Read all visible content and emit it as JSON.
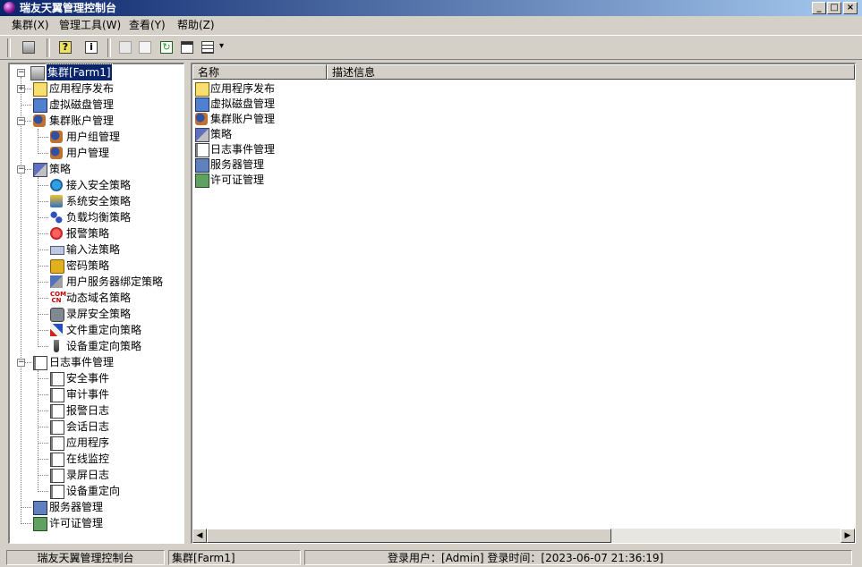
{
  "window": {
    "title": "瑞友天翼管理控制台",
    "min": "_",
    "max": "□",
    "close": "×"
  },
  "menu": [
    "集群(X)",
    "管理工具(W)",
    "查看(Y)",
    "帮助(Z)"
  ],
  "toolbar": {
    "buttons": [
      "cluster-icon",
      "help-icon",
      "info-icon",
      "copy-icon",
      "page-icon",
      "refresh-icon",
      "properties-icon",
      "view-grid-icon"
    ],
    "dropdown": "▾"
  },
  "tree": {
    "root": {
      "label": "集群[Farm1]",
      "expander": "⊟"
    },
    "items": [
      {
        "label": "应用程序发布",
        "icon": "folder-icon",
        "expander": "⊞"
      },
      {
        "label": "虚拟磁盘管理",
        "icon": "disk-icon"
      },
      {
        "label": "集群账户管理",
        "icon": "users-icon",
        "expander": "⊟"
      },
      {
        "label": "用户组管理",
        "icon": "users-icon"
      },
      {
        "label": "用户管理",
        "icon": "users-icon"
      },
      {
        "label": "策略",
        "icon": "policy-icon",
        "expander": "⊟"
      },
      {
        "label": "接入安全策略",
        "icon": "globe-icon"
      },
      {
        "label": "系统安全策略",
        "icon": "shield-icon"
      },
      {
        "label": "负载均衡策略",
        "icon": "network-icon"
      },
      {
        "label": "报警策略",
        "icon": "alarm-icon"
      },
      {
        "label": "输入法策略",
        "icon": "keyboard-icon"
      },
      {
        "label": "密码策略",
        "icon": "lock-icon"
      },
      {
        "label": "用户服务器绑定策略",
        "icon": "bind-icon"
      },
      {
        "label": "动态域名策略",
        "icon": "dns-icon",
        "icon_text": "COM CN"
      },
      {
        "label": "录屏安全策略",
        "icon": "camera-icon"
      },
      {
        "label": "文件重定向策略",
        "icon": "file-redirect-icon"
      },
      {
        "label": "设备重定向策略",
        "icon": "pen-icon"
      },
      {
        "label": "日志事件管理",
        "icon": "log-icon",
        "expander": "⊟"
      },
      {
        "label": "安全事件",
        "icon": "log-icon"
      },
      {
        "label": "审计事件",
        "icon": "log-icon"
      },
      {
        "label": "报警日志",
        "icon": "log-icon"
      },
      {
        "label": "会话日志",
        "icon": "log-icon"
      },
      {
        "label": "应用程序",
        "icon": "log-icon"
      },
      {
        "label": "在线监控",
        "icon": "log-icon"
      },
      {
        "label": "录屏日志",
        "icon": "log-icon"
      },
      {
        "label": "设备重定向",
        "icon": "log-icon"
      },
      {
        "label": "服务器管理",
        "icon": "server-icon"
      },
      {
        "label": "许可证管理",
        "icon": "license-icon"
      }
    ]
  },
  "list": {
    "columns": [
      "名称",
      "描述信息"
    ],
    "rows": [
      {
        "name": "应用程序发布",
        "icon": "folder-icon"
      },
      {
        "name": "虚拟磁盘管理",
        "icon": "disk-icon"
      },
      {
        "name": "集群账户管理",
        "icon": "users-icon"
      },
      {
        "name": "策略",
        "icon": "policy-icon"
      },
      {
        "name": "日志事件管理",
        "icon": "log-icon"
      },
      {
        "name": "服务器管理",
        "icon": "server-icon"
      },
      {
        "name": "许可证管理",
        "icon": "license-icon"
      }
    ]
  },
  "scroll": {
    "left": "◀",
    "right": "▶"
  },
  "status": {
    "app": "瑞友天翼管理控制台",
    "cluster": "集群[Farm1]",
    "session": "登录用户：[Admin] 登录时间：[2023-06-07 21:36:19]"
  },
  "colors": {
    "title_start": "#0a246a",
    "title_end": "#a6caf0",
    "face": "#d4d0c8",
    "selection": "#0a246a"
  }
}
